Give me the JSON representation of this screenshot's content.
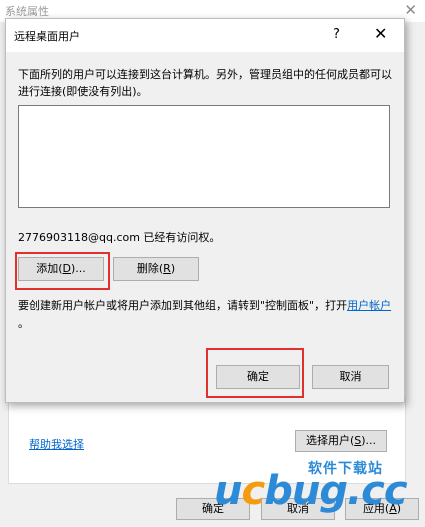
{
  "background_window": {
    "title": "系统属性",
    "close_glyph": "✕",
    "help_link": "帮助我选择",
    "select_users_label": "选择用户(S)...",
    "select_users_mnemonic": "S",
    "ok_label": "确定",
    "cancel_label": "取消",
    "apply_label": "应用(A)",
    "apply_mnemonic": "A"
  },
  "dialog": {
    "title": "远程桌面用户",
    "help_glyph": "?",
    "close_glyph": "✕",
    "description": "下面所列的用户可以连接到这台计算机。另外，管理员组中的任何成员都可以进行连接(即使没有列出)。",
    "users": [],
    "access_text": "2776903118@qq.com 已经有访问权。",
    "add_prefix": "添加(",
    "add_mnemonic": "D",
    "add_suffix": ")...",
    "remove_prefix": "删除(",
    "remove_mnemonic": "R",
    "remove_suffix": ")",
    "note_text": "要创建新用户帐户或将用户添加到其他组，请转到\"控制面板\"，打开",
    "note_link": "用户帐户",
    "note_end": "。",
    "ok_label": "确定",
    "cancel_label": "取消"
  },
  "colors": {
    "highlight": "#e03030",
    "link": "#0066cc",
    "watermark_blue": "#2d8ad6",
    "watermark_orange": "#f39c12"
  },
  "watermark": {
    "cn_text": "软件下载站",
    "u": "u",
    "c": "c",
    "b": "b",
    "u2": "u",
    "g": "g",
    "tld": ".cc"
  }
}
